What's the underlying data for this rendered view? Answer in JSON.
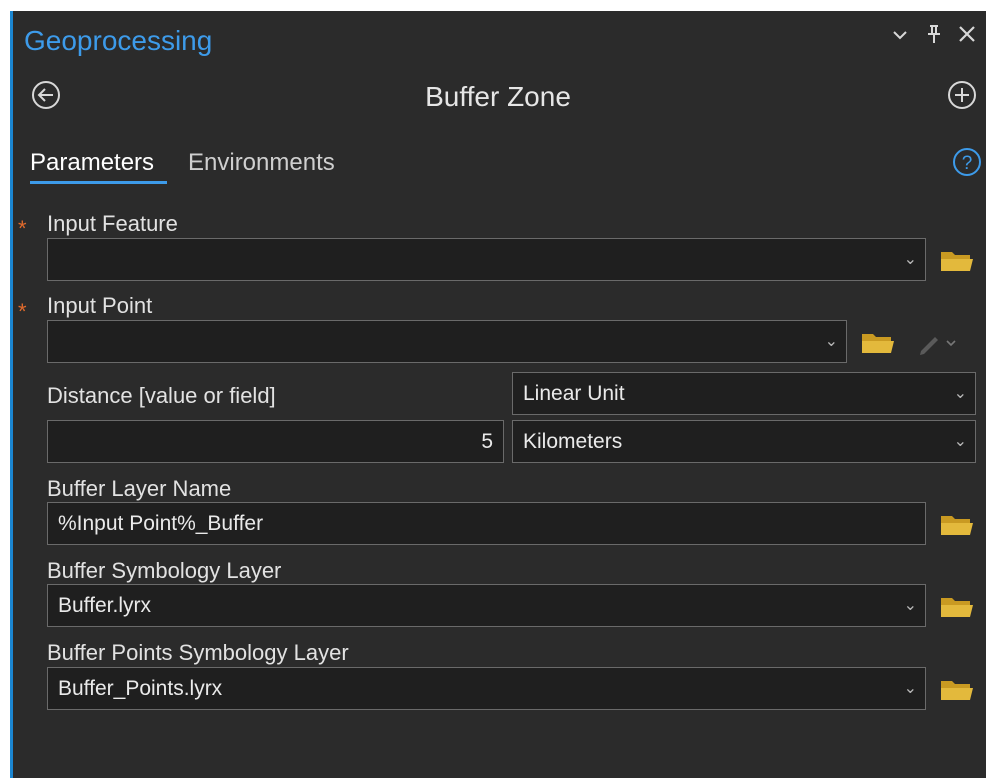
{
  "header": {
    "title": "Geoprocessing",
    "tool_name": "Buffer Zone",
    "icons": [
      "chevron-down-icon",
      "pin-icon",
      "close-icon",
      "back-icon",
      "add-icon"
    ]
  },
  "tabs": {
    "active": "Parameters",
    "inactive": "Environments",
    "help_icon": "help-icon"
  },
  "params": {
    "required_marker": "*",
    "input_feature": {
      "label": "Input Feature",
      "value": ""
    },
    "input_point": {
      "label": "Input Point",
      "value": ""
    },
    "distance": {
      "label": "Distance [value or field]",
      "type": "Linear Unit",
      "value": "5",
      "unit": "Kilometers"
    },
    "buffer_layer_name": {
      "label": "Buffer Layer Name",
      "value": "%Input Point%_Buffer"
    },
    "buffer_symbology": {
      "label": "Buffer Symbology Layer",
      "value": "Buffer.lyrx"
    },
    "buffer_points_symbology": {
      "label": "Buffer Points Symbology Layer",
      "value": "Buffer_Points.lyrx"
    }
  },
  "colors": {
    "background": "#2b2b2b",
    "accent": "#3d9bea",
    "required": "#e06a2c",
    "folder": "#e3b93c"
  }
}
